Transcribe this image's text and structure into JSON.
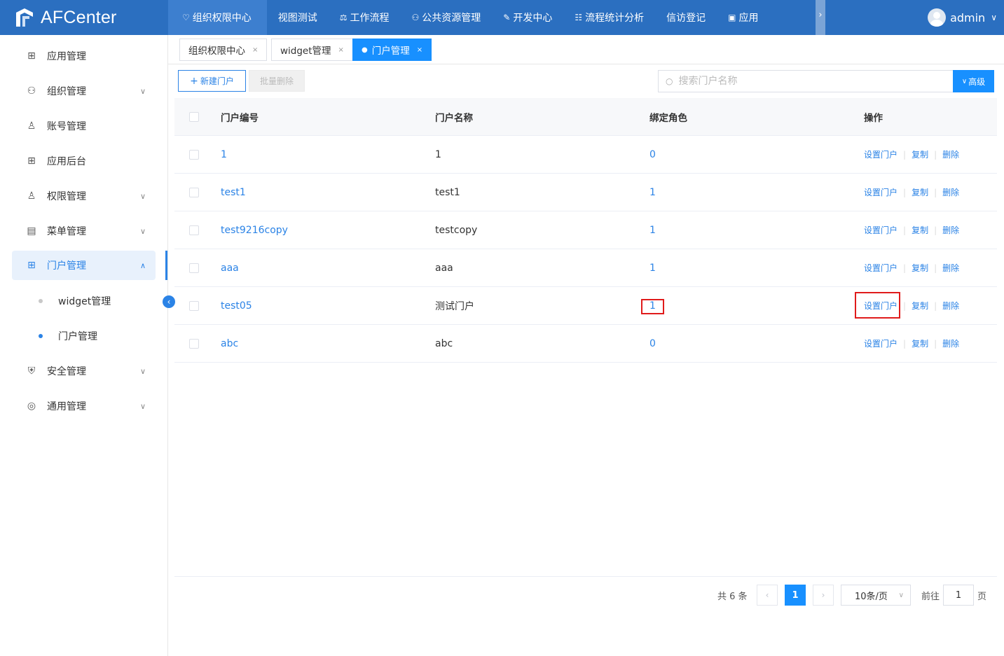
{
  "app": {
    "brand": "AFCenter"
  },
  "topnav": [
    {
      "label": "组织权限中心",
      "icon": "shield-icon",
      "glyph": "♡",
      "active": true
    },
    {
      "label": "视图测试",
      "icon": "",
      "glyph": ""
    },
    {
      "label": "工作流程",
      "icon": "scale-icon",
      "glyph": "⚖"
    },
    {
      "label": "公共资源管理",
      "icon": "people-icon",
      "glyph": "⚇"
    },
    {
      "label": "开发中心",
      "icon": "edit-icon",
      "glyph": "✎"
    },
    {
      "label": "流程统计分析",
      "icon": "stats-icon",
      "glyph": "☷"
    },
    {
      "label": "信访登记",
      "icon": "",
      "glyph": ""
    },
    {
      "label": "应用",
      "icon": "app-icon",
      "glyph": "▣"
    }
  ],
  "user": {
    "name": "admin"
  },
  "sidebar": {
    "items": [
      {
        "label": "应用管理",
        "icon": "grid-icon",
        "glyph": "⊞",
        "expandable": false
      },
      {
        "label": "组织管理",
        "icon": "org-icon",
        "glyph": "⚇",
        "expandable": true
      },
      {
        "label": "账号管理",
        "icon": "user-icon",
        "glyph": "♙",
        "expandable": false
      },
      {
        "label": "应用后台",
        "icon": "grid-icon",
        "glyph": "⊞",
        "expandable": false
      },
      {
        "label": "权限管理",
        "icon": "lock-user-icon",
        "glyph": "♙",
        "expandable": true
      },
      {
        "label": "菜单管理",
        "icon": "menu-icon",
        "glyph": "▤",
        "expandable": true
      },
      {
        "label": "门户管理",
        "icon": "portal-icon",
        "glyph": "⊞",
        "expandable": true,
        "active": true
      },
      {
        "label": "安全管理",
        "icon": "security-icon",
        "glyph": "⛨",
        "expandable": true
      },
      {
        "label": "通用管理",
        "icon": "settings-icon",
        "glyph": "◎",
        "expandable": true
      }
    ],
    "subitems": [
      {
        "label": "widget管理",
        "active": false
      },
      {
        "label": "门户管理",
        "active": true
      }
    ]
  },
  "tabs": [
    {
      "label": "组织权限中心",
      "active": false
    },
    {
      "label": "widget管理",
      "active": false
    },
    {
      "label": "门户管理",
      "active": true
    }
  ],
  "toolbar": {
    "new_label": "新建门户",
    "batch_delete_label": "批量删除",
    "advanced_label": "高级"
  },
  "search": {
    "placeholder": "搜索门户名称",
    "value": ""
  },
  "table": {
    "columns": [
      "门户编号",
      "门户名称",
      "绑定角色",
      "操作"
    ],
    "rows": [
      {
        "id": "1",
        "name": "1",
        "roles": "0"
      },
      {
        "id": "test1",
        "name": "test1",
        "roles": "1"
      },
      {
        "id": "test9216copy",
        "name": "testcopy",
        "roles": "1"
      },
      {
        "id": "aaa",
        "name": "aaa",
        "roles": "1"
      },
      {
        "id": "test05",
        "name": "测试门户",
        "roles": "1",
        "highlighted": true
      },
      {
        "id": "abc",
        "name": "abc",
        "roles": "0"
      }
    ],
    "actions": [
      "设置门户",
      "复制",
      "删除"
    ]
  },
  "pagination": {
    "total_text": "共 6 条",
    "current_page": "1",
    "page_size": "10条/页",
    "goto_label": "前往",
    "goto_value": "1",
    "page_suffix": "页"
  },
  "colors": {
    "topbar": "#2b6fc0",
    "accent": "#1890ff",
    "highlight": "#e01b1b"
  }
}
